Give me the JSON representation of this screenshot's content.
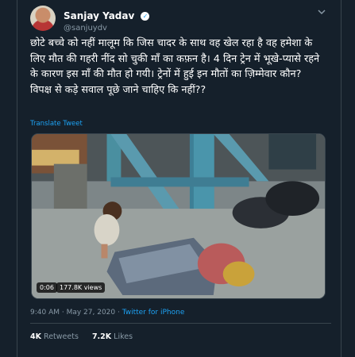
{
  "user": {
    "display_name": "Sanjay Yadav",
    "handle": "@sanjuydv",
    "verified": true
  },
  "tweet": {
    "text": "छोटे बच्चे को नहीं मालूम कि जिस चादर के साथ वह खेल रहा है वह हमेशा के लिए मौत की गहरी नींद सो चुकी माँ का कफ़न है। 4 दिन ट्रेन में भूखे-प्यासे रहने के कारण इस माँ की मौत हो गयी। ट्रेनों में हुई इन मौतों का ज़िम्मेवार कौन? विपक्ष से कड़े सवाल पूछे जाने चाहिए कि नहीं??",
    "translate_label": "Translate Tweet"
  },
  "video": {
    "elapsed": "0:06",
    "views": "177.8K views"
  },
  "meta": {
    "time": "9:40 AM · May 27, 2020 · ",
    "source": "Twitter for iPhone"
  },
  "stats": {
    "retweets_count": "4K",
    "retweets_label": "Retweets",
    "likes_count": "7.2K",
    "likes_label": "Likes"
  },
  "icons": {
    "verified": "verified-badge-icon",
    "more": "chevron-down-icon"
  },
  "colors": {
    "background": "#15202b",
    "accent": "#1da1f2",
    "secondary_text": "#8899a6",
    "border": "#38444d"
  }
}
